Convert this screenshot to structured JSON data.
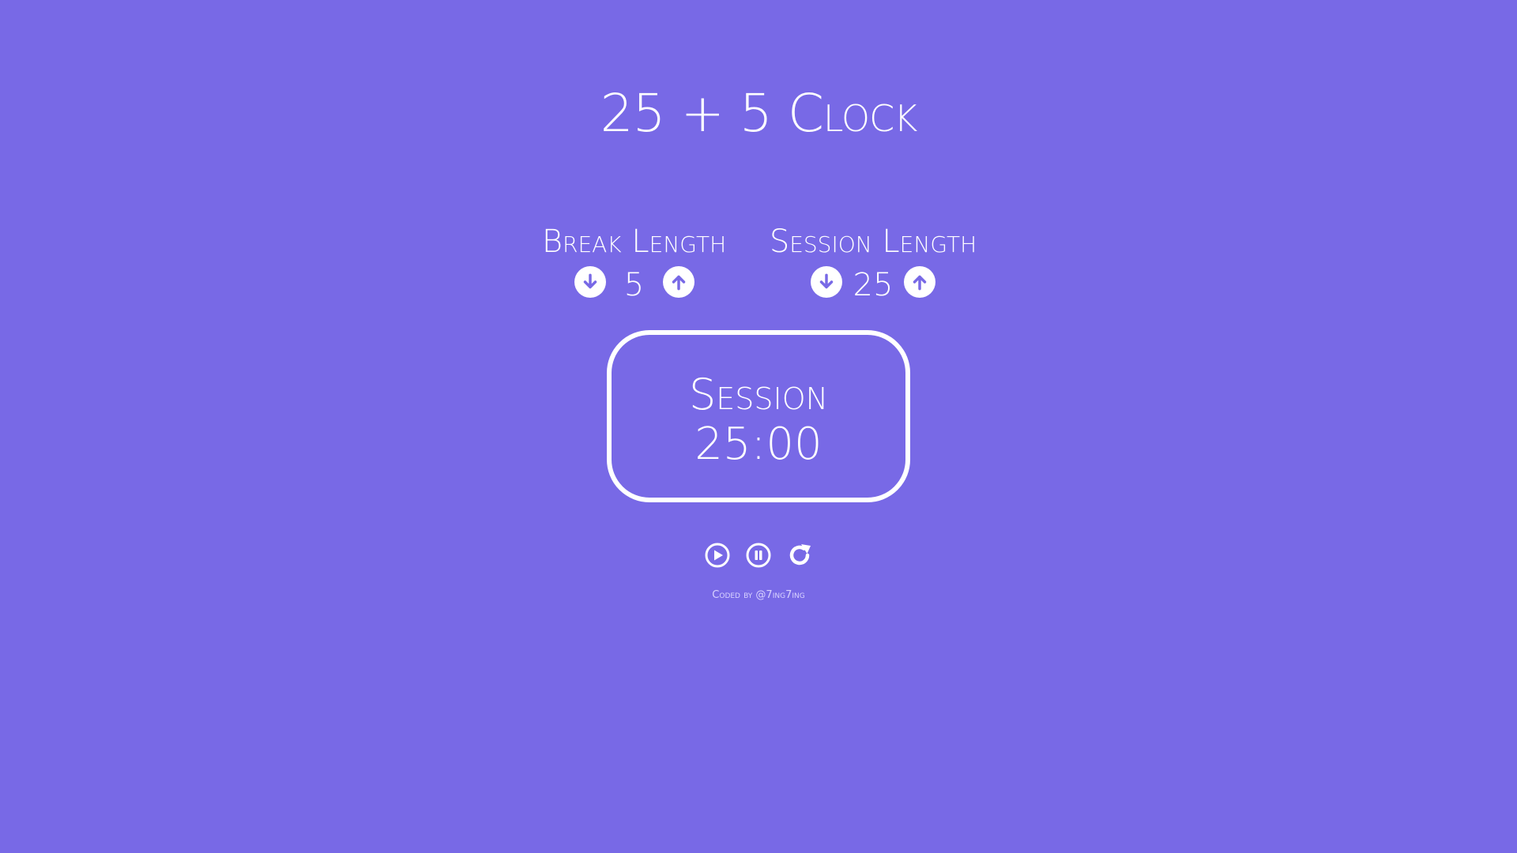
{
  "app": {
    "title": "25 + 5 Clock",
    "background_color": "#7869e6",
    "foreground_color": "#ffffff"
  },
  "break_control": {
    "label": "Break Length",
    "value": "5",
    "decrement_icon": "arrow-down-circle-icon",
    "increment_icon": "arrow-up-circle-icon"
  },
  "session_control": {
    "label": "Session Length",
    "value": "25",
    "decrement_icon": "arrow-down-circle-icon",
    "increment_icon": "arrow-up-circle-icon"
  },
  "timer": {
    "label": "Session",
    "time_left": "25:00"
  },
  "controls": {
    "play_icon": "play-circle-icon",
    "pause_icon": "pause-circle-icon",
    "reset_icon": "refresh-icon"
  },
  "credit": {
    "text": "Coded by @7ing7ing"
  }
}
